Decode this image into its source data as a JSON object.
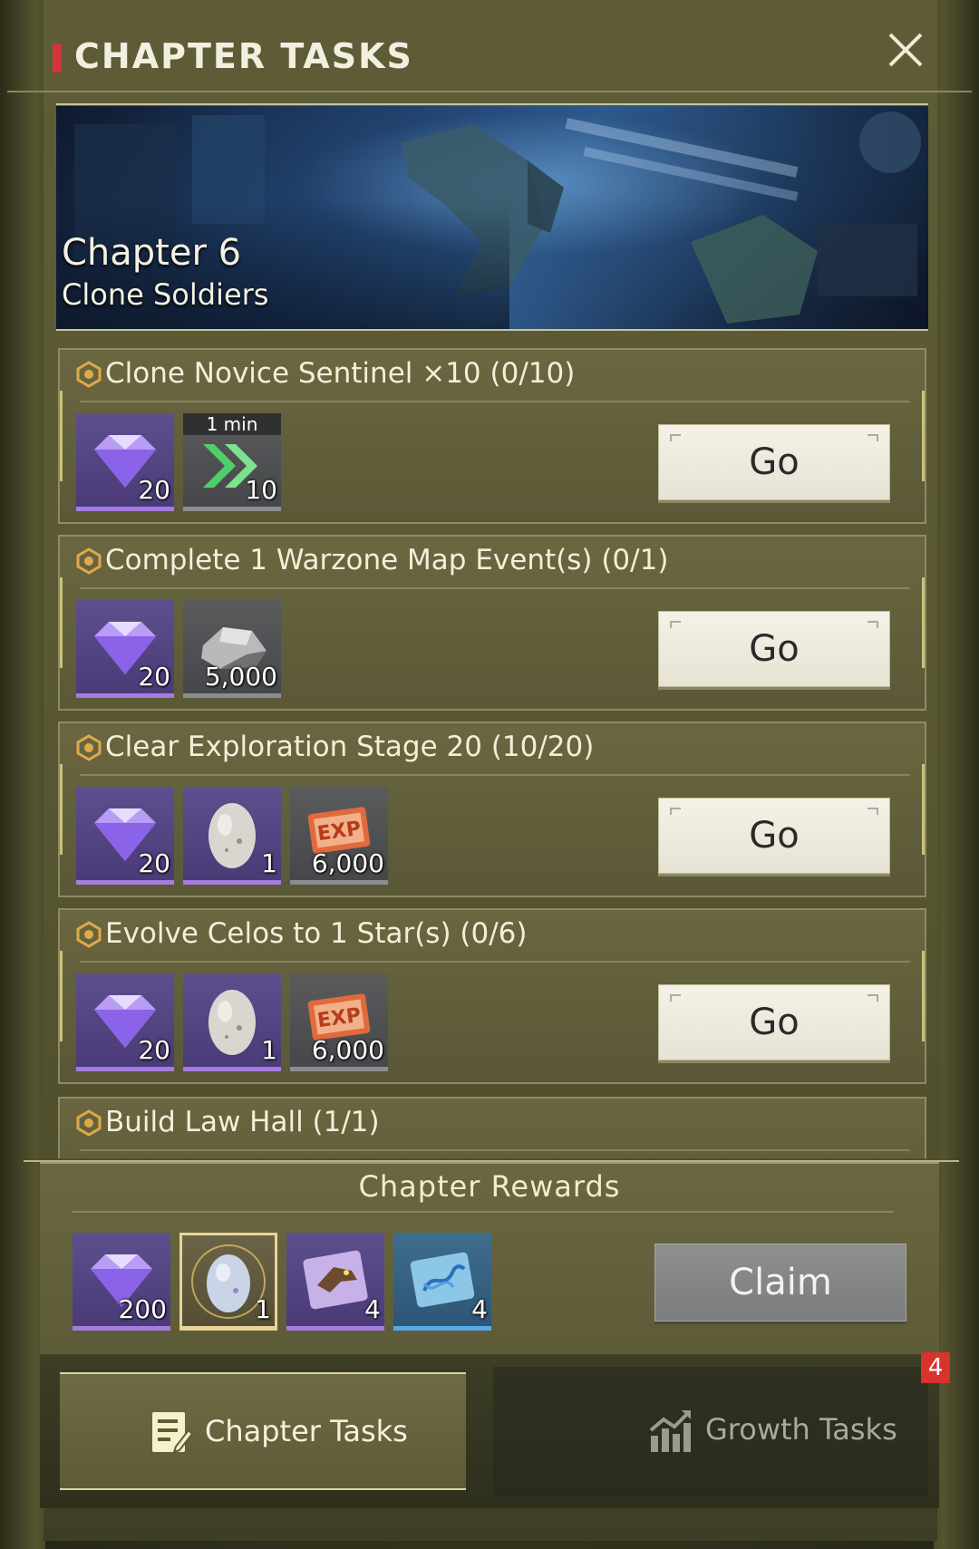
{
  "header": {
    "title": "CHAPTER TASKS"
  },
  "banner": {
    "chapter_number": "Chapter 6",
    "chapter_name": "Clone Soldiers"
  },
  "tasks": [
    {
      "title": "Clone Novice Sentinel ×10 (0/10)",
      "button": "Go",
      "rewards": [
        {
          "icon": "diamond-icon",
          "rarity": "purple",
          "qty": "20"
        },
        {
          "icon": "speedup-arrows-icon",
          "rarity": "grey",
          "qty": "10",
          "timer": "1 min"
        }
      ]
    },
    {
      "title": "Complete 1 Warzone Map Event(s) (0/1)",
      "button": "Go",
      "rewards": [
        {
          "icon": "diamond-icon",
          "rarity": "purple",
          "qty": "20"
        },
        {
          "icon": "iron-ore-icon",
          "rarity": "grey",
          "qty": "5,000"
        }
      ]
    },
    {
      "title": "Clear Exploration Stage 20 (10/20)",
      "button": "Go",
      "rewards": [
        {
          "icon": "diamond-icon",
          "rarity": "purple",
          "qty": "20"
        },
        {
          "icon": "dino-egg-icon",
          "rarity": "purple",
          "qty": "1"
        },
        {
          "icon": "exp-card-icon",
          "rarity": "grey",
          "qty": "6,000",
          "label": "EXP"
        }
      ]
    },
    {
      "title": "Evolve Celos to 1 Star(s) (0/6)",
      "button": "Go",
      "rewards": [
        {
          "icon": "diamond-icon",
          "rarity": "purple",
          "qty": "20"
        },
        {
          "icon": "dino-egg-icon",
          "rarity": "purple",
          "qty": "1"
        },
        {
          "icon": "exp-card-icon",
          "rarity": "grey",
          "qty": "6,000",
          "label": "EXP"
        }
      ]
    },
    {
      "title": "Build Law Hall (1/1)"
    }
  ],
  "chapter_rewards": {
    "title": "Chapter Rewards",
    "button": "Claim",
    "items": [
      {
        "icon": "diamond-icon",
        "rarity": "purple",
        "qty": "200"
      },
      {
        "icon": "golden-dino-egg-icon",
        "rarity": "gold",
        "qty": "1"
      },
      {
        "icon": "dino-card-icon",
        "rarity": "purple",
        "qty": "4"
      },
      {
        "icon": "dna-card-icon",
        "rarity": "blue",
        "qty": "4"
      }
    ]
  },
  "tabs": [
    {
      "label": "Chapter Tasks",
      "active": true
    },
    {
      "label": "Growth Tasks",
      "active": false,
      "badge": "4"
    }
  ],
  "colors": {
    "accent_red": "#d4333a",
    "badge_red": "#d8332c",
    "go_button": "#f4f1e6",
    "claim_button": "#8e8f8f"
  }
}
